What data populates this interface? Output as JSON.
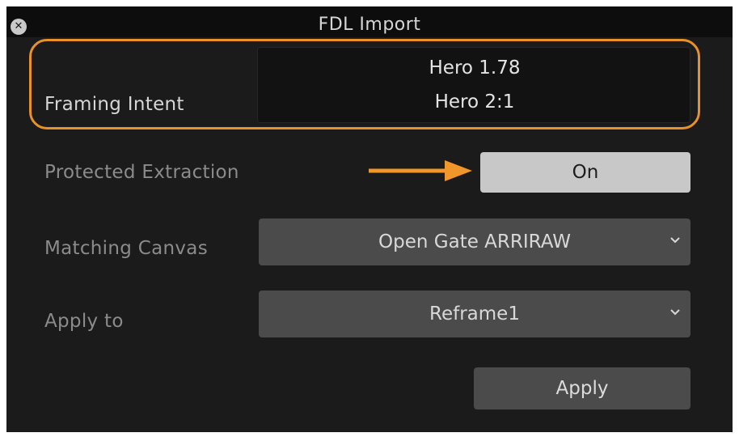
{
  "window": {
    "title": "FDL Import",
    "close_icon": "close-icon"
  },
  "framing_intent": {
    "label": "Framing Intent",
    "options": [
      "Hero 1.78",
      "Hero 2:1"
    ],
    "highlight_color": "#e8912a"
  },
  "protected_extraction": {
    "label": "Protected Extraction",
    "value": "On",
    "arrow_icon": "arrow-right-icon",
    "arrow_color": "#f0962a"
  },
  "matching_canvas": {
    "label": "Matching Canvas",
    "value": "Open Gate ARRIRAW",
    "icon": "chevron-down-icon"
  },
  "apply_to": {
    "label": "Apply to",
    "value": "Reframe1",
    "icon": "chevron-down-icon"
  },
  "actions": {
    "apply_label": "Apply"
  }
}
